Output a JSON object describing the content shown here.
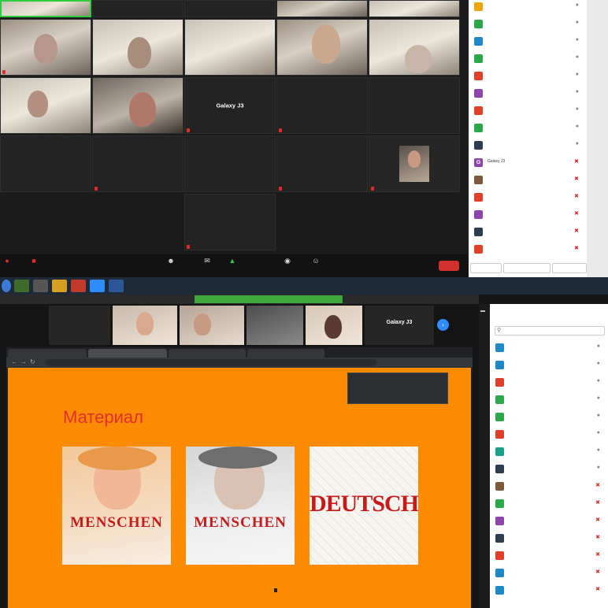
{
  "top_meeting": {
    "grid_top_labels": [
      "",
      "",
      "",
      "",
      ""
    ],
    "tiles": [
      {
        "label": "",
        "muted": true,
        "type": "cam"
      },
      {
        "label": "",
        "muted": false,
        "type": "cam2"
      },
      {
        "label": "",
        "muted": false,
        "type": "cam2"
      },
      {
        "label": "",
        "muted": false,
        "type": "cam"
      },
      {
        "label": "",
        "muted": false,
        "type": "cam2"
      },
      {
        "label": "",
        "muted": false,
        "type": "cam3"
      },
      {
        "label": "",
        "muted": false,
        "type": "cam"
      },
      {
        "big": "Galaxy J3",
        "label": "",
        "muted": true
      },
      {
        "big": "",
        "label": "",
        "muted": true
      },
      {
        "big": "",
        "label": "",
        "muted": false
      },
      {
        "big": "",
        "label": "",
        "muted": false
      },
      {
        "big": "",
        "label": "",
        "muted": true
      },
      {
        "big": "",
        "label": "",
        "muted": false
      },
      {
        "big": "",
        "label": "",
        "muted": true
      },
      {
        "label": "",
        "muted": true,
        "type": "cam"
      },
      {
        "big": "",
        "label": "",
        "muted": true
      }
    ],
    "toolbar": {
      "audio": "",
      "video": "",
      "participants": "",
      "chat": "",
      "share": "",
      "record": "",
      "reactions": "",
      "leave": ""
    },
    "participants": [
      {
        "name": "",
        "color": "#f0a500",
        "letter": "",
        "mic_off": false
      },
      {
        "name": "",
        "color": "#2aa84a",
        "letter": "",
        "mic_off": false
      },
      {
        "name": "",
        "color": "#1e88c8",
        "letter": "",
        "mic_off": false
      },
      {
        "name": "",
        "color": "#2aa84a",
        "letter": "",
        "mic_off": false
      },
      {
        "name": "",
        "color": "#e0402a",
        "letter": "",
        "mic_off": false
      },
      {
        "name": "",
        "color": "#8e44ad",
        "letter": "",
        "mic_off": false
      },
      {
        "name": "",
        "color": "#e0402a",
        "letter": "",
        "mic_off": false
      },
      {
        "name": "",
        "color": "#2aa84a",
        "letter": "",
        "mic_off": false
      },
      {
        "name": "",
        "color": "#2c3e50",
        "letter": "",
        "mic_off": false
      },
      {
        "name": "Galaxy J3",
        "color": "#8e44ad",
        "letter": "G",
        "mic_off": true
      },
      {
        "name": "",
        "color": "#7a5a3a",
        "letter": "",
        "mic_off": true
      },
      {
        "name": "",
        "color": "#e0402a",
        "letter": "",
        "mic_off": true
      },
      {
        "name": "",
        "color": "#8e44ad",
        "letter": "",
        "mic_off": true
      },
      {
        "name": "",
        "color": "#2c3e50",
        "letter": "",
        "mic_off": true
      },
      {
        "name": "",
        "color": "#e0402a",
        "letter": "",
        "mic_off": true
      }
    ],
    "list_buttons": [
      "",
      "",
      ""
    ]
  },
  "taskbar": {
    "lang": "",
    "time": "",
    "date": ""
  },
  "bottom_meeting": {
    "window_title": "",
    "share_notice": "",
    "view_options": "",
    "strip": [
      {
        "big": "",
        "label": ""
      },
      {
        "label": "",
        "cam": true
      },
      {
        "label": "",
        "cam": true
      },
      {
        "label": "",
        "cam": true
      },
      {
        "label": "",
        "cam": true
      },
      {
        "big": "Galaxy J3",
        "label": ""
      }
    ],
    "browser": {
      "tabs": [
        "",
        "",
        "",
        ""
      ],
      "url": "",
      "popup_tabs": [
        "",
        ""
      ],
      "popup_hint": ""
    },
    "page": {
      "title": "Материал",
      "books": [
        {
          "brand": "MENSCHEN",
          "subtitle": "",
          "caption": ""
        },
        {
          "brand": "MENSCHEN",
          "subtitle": "",
          "caption": ""
        },
        {
          "brand": "DEUTSCH",
          "subtitle": "",
          "caption": ""
        }
      ]
    },
    "participants_header": "",
    "participants_search": "",
    "participants": [
      {
        "name": "",
        "color": "#1e88c8",
        "letter": "",
        "mic_off": false
      },
      {
        "name": "",
        "color": "#1e88c8",
        "letter": "",
        "mic_off": false
      },
      {
        "name": "",
        "color": "#e0402a",
        "letter": "",
        "mic_off": false
      },
      {
        "name": "",
        "color": "#2aa84a",
        "letter": "",
        "mic_off": false
      },
      {
        "name": "",
        "color": "#2aa84a",
        "letter": "",
        "mic_off": false
      },
      {
        "name": "",
        "color": "#e0402a",
        "letter": "",
        "mic_off": false
      },
      {
        "name": "",
        "color": "#1aa08a",
        "letter": "",
        "mic_off": false
      },
      {
        "name": "",
        "color": "#2c3e50",
        "letter": "",
        "mic_off": false
      },
      {
        "name": "",
        "color": "#7a5a3a",
        "letter": "",
        "mic_off": true
      },
      {
        "name": "",
        "color": "#2aa84a",
        "letter": "",
        "mic_off": true
      },
      {
        "name": "",
        "color": "#8e44ad",
        "letter": "",
        "mic_off": true
      },
      {
        "name": "",
        "color": "#2c3e50",
        "letter": "",
        "mic_off": true
      },
      {
        "name": "",
        "color": "#e0402a",
        "letter": "",
        "mic_off": true
      },
      {
        "name": "",
        "color": "#1e88c8",
        "letter": "",
        "mic_off": true
      },
      {
        "name": "",
        "color": "#1e88c8",
        "letter": "",
        "mic_off": true
      }
    ]
  }
}
